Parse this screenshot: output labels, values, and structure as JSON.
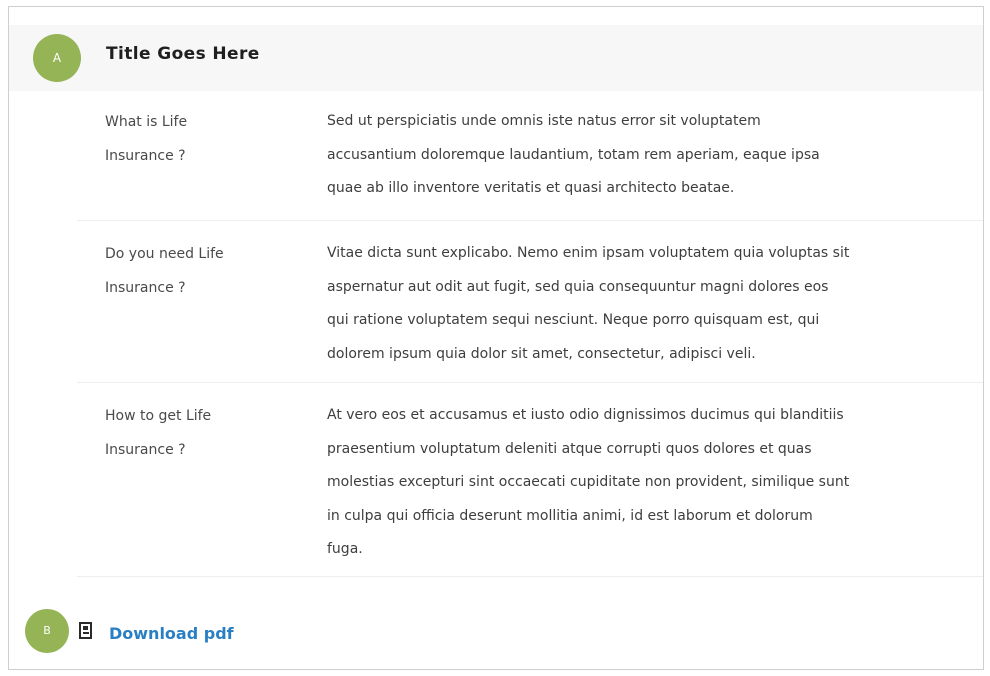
{
  "header": {
    "marker_label": "A",
    "title": "Title Goes Here"
  },
  "faq": [
    {
      "question_lines": [
        "What is Life",
        "Insurance ?"
      ],
      "answer_lines": [
        "Sed ut perspiciatis unde omnis iste natus error sit voluptatem",
        "accusantium doloremque laudantium, totam rem aperiam, eaque ipsa",
        "quae ab illo inventore veritatis et quasi architecto beatae."
      ]
    },
    {
      "question_lines": [
        "Do you need Life",
        "Insurance ?"
      ],
      "answer_lines": [
        "Vitae dicta sunt explicabo. Nemo enim ipsam voluptatem quia voluptas sit",
        "aspernatur aut odit aut fugit, sed quia consequuntur magni dolores eos",
        "qui ratione voluptatem sequi nesciunt. Neque porro quisquam est, qui",
        "dolorem ipsum quia dolor sit amet, consectetur, adipisci veli."
      ]
    },
    {
      "question_lines": [
        "How to get Life",
        "Insurance ?"
      ],
      "answer_lines": [
        "At vero eos et accusamus et iusto odio dignissimos ducimus qui blanditiis",
        "praesentium voluptatum deleniti atque corrupti quos dolores et quas",
        "molestias excepturi sint occaecati cupiditate non provident, similique sunt",
        "in culpa qui officia deserunt mollitia animi, id est laborum et dolorum",
        "fuga."
      ]
    }
  ],
  "footer": {
    "marker_label": "B",
    "icon": "pdf-file-icon",
    "download_label": "Download pdf"
  },
  "colors": {
    "marker": "#94b456",
    "link": "#2a7fc4",
    "header_bg": "#f7f7f7"
  }
}
